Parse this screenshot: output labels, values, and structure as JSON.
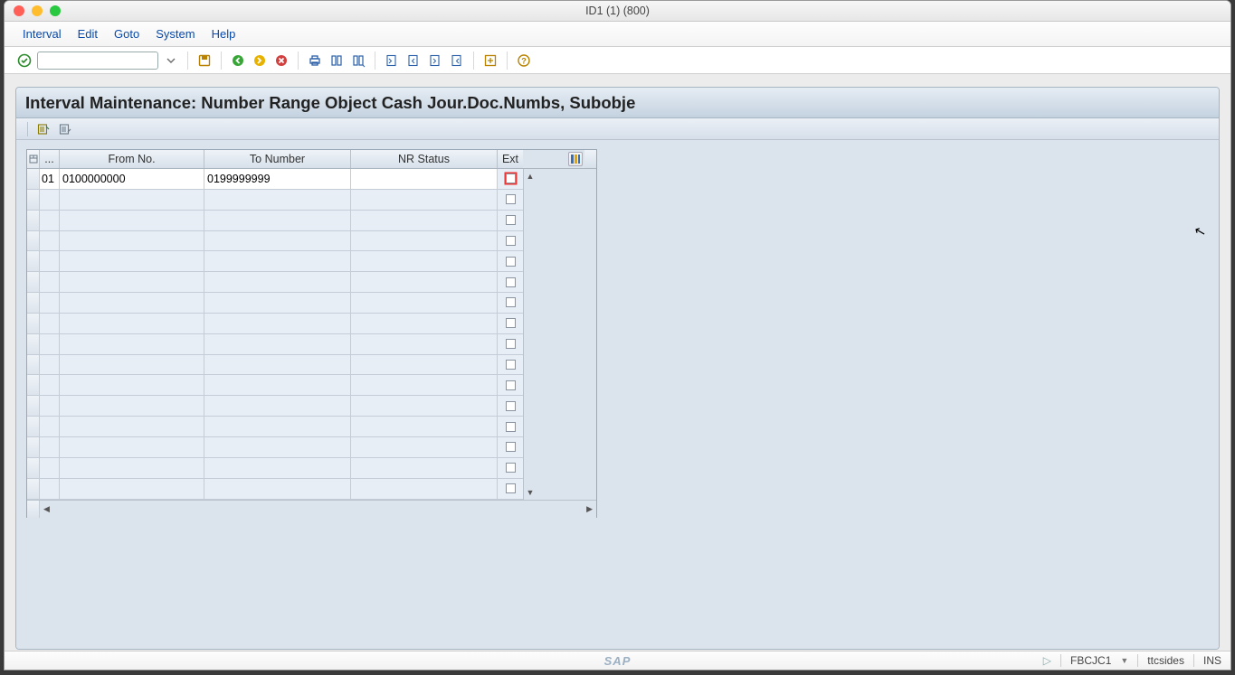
{
  "window_title": "ID1 (1) (800)",
  "menu": {
    "interval": "Interval",
    "edit": "Edit",
    "goto": "Goto",
    "system": "System",
    "help": "Help"
  },
  "page_title": "Interval Maintenance: Number Range Object Cash Jour.Doc.Numbs, Subobje",
  "table": {
    "headers": {
      "no": "...",
      "from": "From No.",
      "to": "To Number",
      "nrstatus": "NR Status",
      "ext": "Ext"
    },
    "rows": [
      {
        "no": "01",
        "from": "0100000000",
        "to": "0199999999",
        "nr": "",
        "ext": false,
        "highlight_ext": true
      },
      {
        "no": "",
        "from": "",
        "to": "",
        "nr": "",
        "ext": false
      },
      {
        "no": "",
        "from": "",
        "to": "",
        "nr": "",
        "ext": false
      },
      {
        "no": "",
        "from": "",
        "to": "",
        "nr": "",
        "ext": false
      },
      {
        "no": "",
        "from": "",
        "to": "",
        "nr": "",
        "ext": false
      },
      {
        "no": "",
        "from": "",
        "to": "",
        "nr": "",
        "ext": false
      },
      {
        "no": "",
        "from": "",
        "to": "",
        "nr": "",
        "ext": false
      },
      {
        "no": "",
        "from": "",
        "to": "",
        "nr": "",
        "ext": false
      },
      {
        "no": "",
        "from": "",
        "to": "",
        "nr": "",
        "ext": false
      },
      {
        "no": "",
        "from": "",
        "to": "",
        "nr": "",
        "ext": false
      },
      {
        "no": "",
        "from": "",
        "to": "",
        "nr": "",
        "ext": false
      },
      {
        "no": "",
        "from": "",
        "to": "",
        "nr": "",
        "ext": false
      },
      {
        "no": "",
        "from": "",
        "to": "",
        "nr": "",
        "ext": false
      },
      {
        "no": "",
        "from": "",
        "to": "",
        "nr": "",
        "ext": false
      },
      {
        "no": "",
        "from": "",
        "to": "",
        "nr": "",
        "ext": false
      },
      {
        "no": "",
        "from": "",
        "to": "",
        "nr": "",
        "ext": false
      }
    ]
  },
  "status": {
    "tcode": "FBCJC1",
    "user": "ttcsides",
    "mode": "INS"
  }
}
